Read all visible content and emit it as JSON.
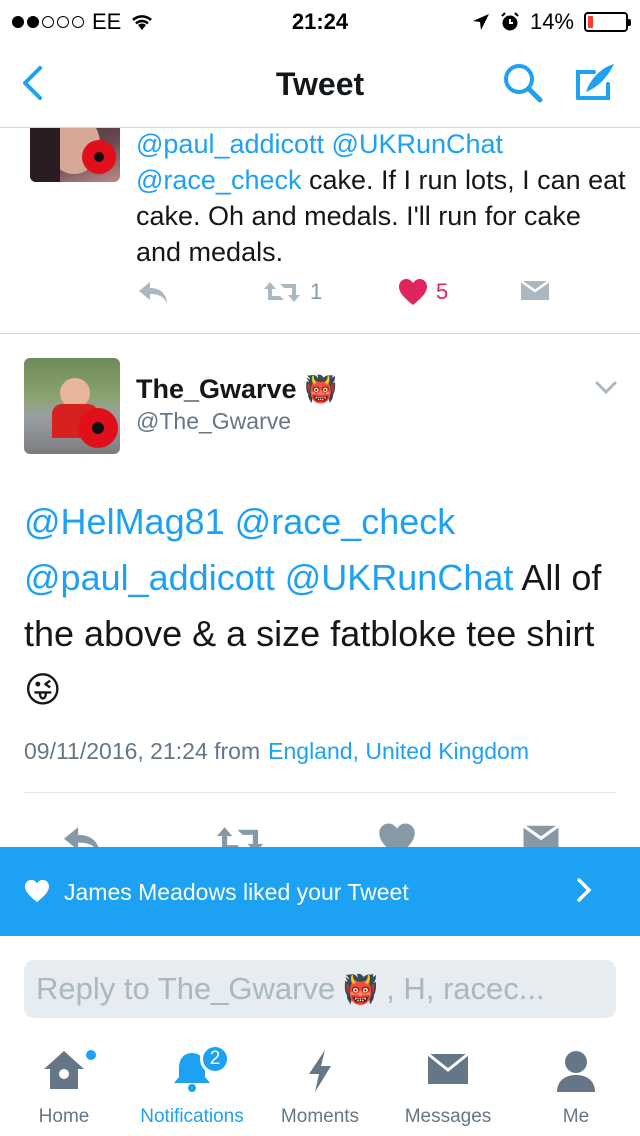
{
  "status_bar": {
    "carrier": "EE",
    "time": "21:24",
    "battery": "14%",
    "battery_fraction": 0.14
  },
  "nav": {
    "title": "Tweet",
    "back_icon": "chevron-left-icon",
    "search_icon": "search-icon",
    "compose_icon": "compose-icon"
  },
  "prev_tweet": {
    "line1": "@paul_addicott @UKRunChat",
    "mention": "@race_check",
    "text": " cake. If I run lots, I can eat cake. Oh and medals. I'll run for cake and medals.",
    "retweets": "1",
    "likes": "5"
  },
  "tweet": {
    "display_name": "The_Gwarve",
    "handle": "@The_Gwarve",
    "mentions": [
      "@HelMag81",
      "@race_check",
      "@paul_addicott",
      "@UKRunChat"
    ],
    "text": "All of the above & a size fatbloke tee shirt",
    "emoji": "😜",
    "timestamp": "09/11/2016, 21:24 from",
    "location": "England, United Kingdom"
  },
  "banner": {
    "text": "James Meadows liked your Tweet"
  },
  "reply": {
    "prefix": "Reply to The_Gwarve",
    "suffix": ", H, racec..."
  },
  "tabs": [
    {
      "label": "Home",
      "icon": "home-icon"
    },
    {
      "label": "Notifications",
      "icon": "bell-icon",
      "badge": "2"
    },
    {
      "label": "Moments",
      "icon": "lightning-icon"
    },
    {
      "label": "Messages",
      "icon": "envelope-icon"
    },
    {
      "label": "Me",
      "icon": "person-icon"
    }
  ],
  "colors": {
    "accent": "#1da1f2",
    "like": "#e0245e",
    "muted": "#8899a6"
  }
}
